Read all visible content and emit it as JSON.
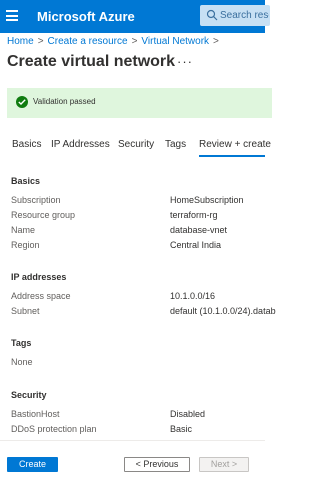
{
  "header": {
    "brand": "Microsoft Azure",
    "search_placeholder": "Search resou"
  },
  "breadcrumb": [
    {
      "label": "Home"
    },
    {
      "label": "Create a resource"
    },
    {
      "label": "Virtual Network"
    }
  ],
  "breadcrumb_separator": ">",
  "page": {
    "title": "Create virtual network",
    "more": "···"
  },
  "validation": {
    "text": "Validation passed",
    "color": "#107c10"
  },
  "tabs": [
    {
      "label": "Basics"
    },
    {
      "label": "IP Addresses"
    },
    {
      "label": "Security"
    },
    {
      "label": "Tags"
    },
    {
      "label": "Review + create",
      "active": true
    }
  ],
  "sections": {
    "basics": {
      "title": "Basics",
      "rows": [
        {
          "label": "Subscription",
          "value": "HomeSubscription"
        },
        {
          "label": "Resource group",
          "value": "terraform-rg"
        },
        {
          "label": "Name",
          "value": "database-vnet"
        },
        {
          "label": "Region",
          "value": "Central India"
        }
      ]
    },
    "ip": {
      "title": "IP addresses",
      "rows": [
        {
          "label": "Address space",
          "value": "10.1.0.0/16"
        },
        {
          "label": "Subnet",
          "value": "default (10.1.0.0/24).datab"
        }
      ]
    },
    "tags": {
      "title": "Tags",
      "rows": [
        {
          "label": "None",
          "value": ""
        }
      ]
    },
    "security": {
      "title": "Security",
      "rows": [
        {
          "label": "BastionHost",
          "value": "Disabled"
        },
        {
          "label": "DDoS protection plan",
          "value": "Basic"
        }
      ]
    }
  },
  "footer": {
    "create": "Create",
    "previous": "< Previous",
    "next": "Next >"
  },
  "colors": {
    "accent": "#0078d4",
    "success_bg": "#dff6dd"
  }
}
